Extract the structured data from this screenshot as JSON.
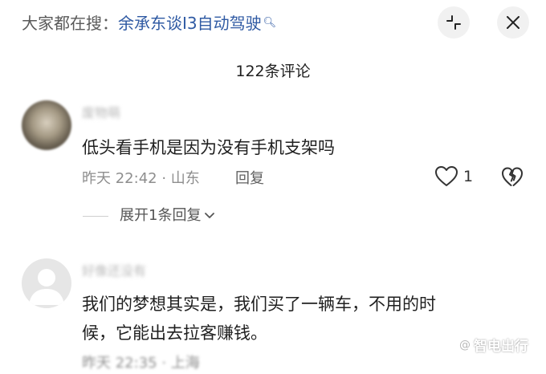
{
  "header": {
    "trending_prefix": "大家都在搜：",
    "trending_query": "余承东谈I3自动驾驶",
    "title": "122条评论"
  },
  "comments": [
    {
      "username": "废物萌",
      "text": "低头看手机是因为没有手机支架吗",
      "meta": "昨天 22:42 · 山东",
      "reply_label": "回复",
      "like_count": "1",
      "expand_label": "展开1条回复"
    },
    {
      "username": "好像还没有",
      "text_line1": "我们的梦想其实是，我们买了一辆车，不用的时",
      "text_line2": "候，它能出去拉客赚钱。",
      "meta": "昨天 22:35 · 上海"
    }
  ],
  "watermark": {
    "at": "@",
    "text": "智电出行"
  },
  "icons": {
    "search": "search-icon",
    "collapse": "collapse-icon",
    "close": "close-icon",
    "like": "heart-icon",
    "dislike": "broken-heart-icon",
    "expand": "chevron-down-icon"
  }
}
